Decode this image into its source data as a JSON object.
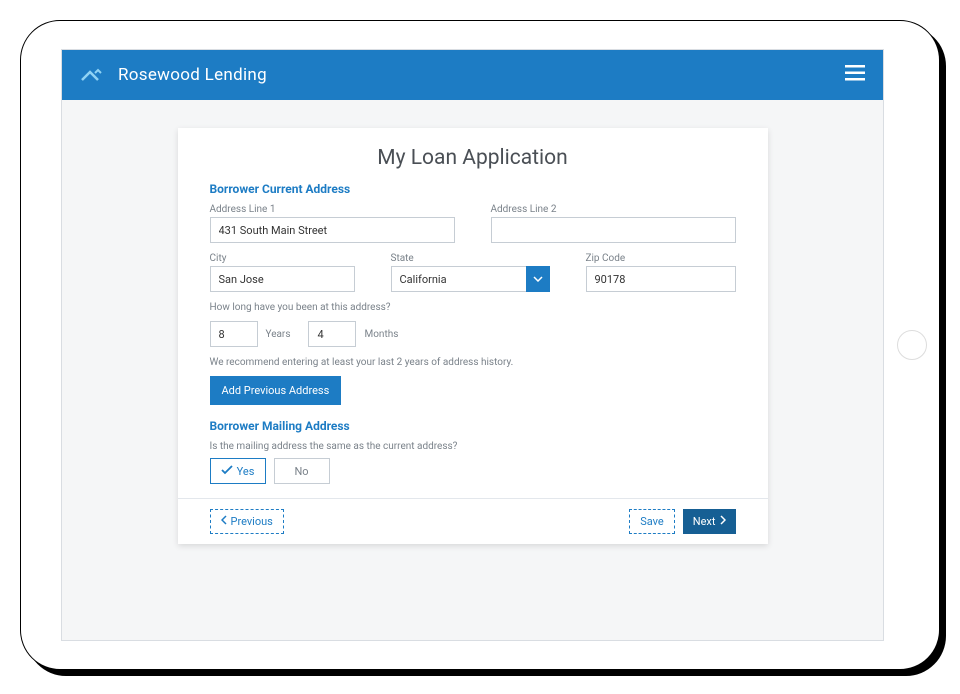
{
  "brand": {
    "title": "Rosewood Lending"
  },
  "page": {
    "title": "My Loan Application"
  },
  "sections": {
    "current": {
      "title": "Borrower Current Address",
      "address1_label": "Address Line 1",
      "address1_value": "431 South Main Street",
      "address2_label": "Address Line 2",
      "address2_value": "",
      "city_label": "City",
      "city_value": "San Jose",
      "state_label": "State",
      "state_value": "California",
      "zip_label": "Zip Code",
      "zip_value": "90178",
      "duration_question": "How long have you been at this address?",
      "years_value": "8",
      "years_label": "Years",
      "months_value": "4",
      "months_label": "Months",
      "hint": "We recommend entering at least your last 2 years of address history.",
      "add_button": "Add Previous Address"
    },
    "mailing": {
      "title": "Borrower Mailing Address",
      "question": "Is the mailing address the same as the current address?",
      "yes": "Yes",
      "no": "No"
    }
  },
  "footer": {
    "previous": "Previous",
    "save": "Save",
    "next": "Next"
  }
}
